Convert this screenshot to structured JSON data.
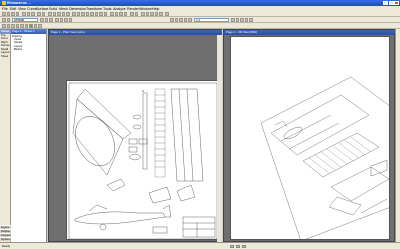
{
  "app": {
    "title": "Rhinoceros ..."
  },
  "menu": [
    "File",
    "Edit",
    "View",
    "Curve",
    "Surface",
    "Solid",
    "Mesh",
    "Dimension",
    "Transform",
    "Tools",
    "Analyze",
    "Render",
    "Window",
    "Help"
  ],
  "toolbar": {
    "layer_combo": "Default",
    "zoom_combo": "1:1"
  },
  "left_panel": {
    "header": "Views",
    "items": [
      "Top",
      "Front",
      "Right",
      "Perspective",
      "Detail",
      "Layout",
      "Sheet"
    ],
    "bottom_items": [
      "Layers",
      "Display",
      "Properties",
      "Options"
    ]
  },
  "nav_panel": {
    "header": "Page 1 - Sheet 1",
    "tree": [
      "Drawing",
      "Views",
      "Sheets",
      "Layers",
      "Blocks"
    ]
  },
  "viewport_left": {
    "title": "Page 1 - Plan View (wire)"
  },
  "viewport_right": {
    "title": "Page 1 - 3D View [ISO]"
  },
  "status": {
    "left": "Ready",
    "coords": "",
    "units": ""
  },
  "colors": {
    "titlebar": "#1c4fb6",
    "mdi_title": "#2a4ea8",
    "chrome": "#ece9d8",
    "accent_icon": "#3cb44b"
  }
}
